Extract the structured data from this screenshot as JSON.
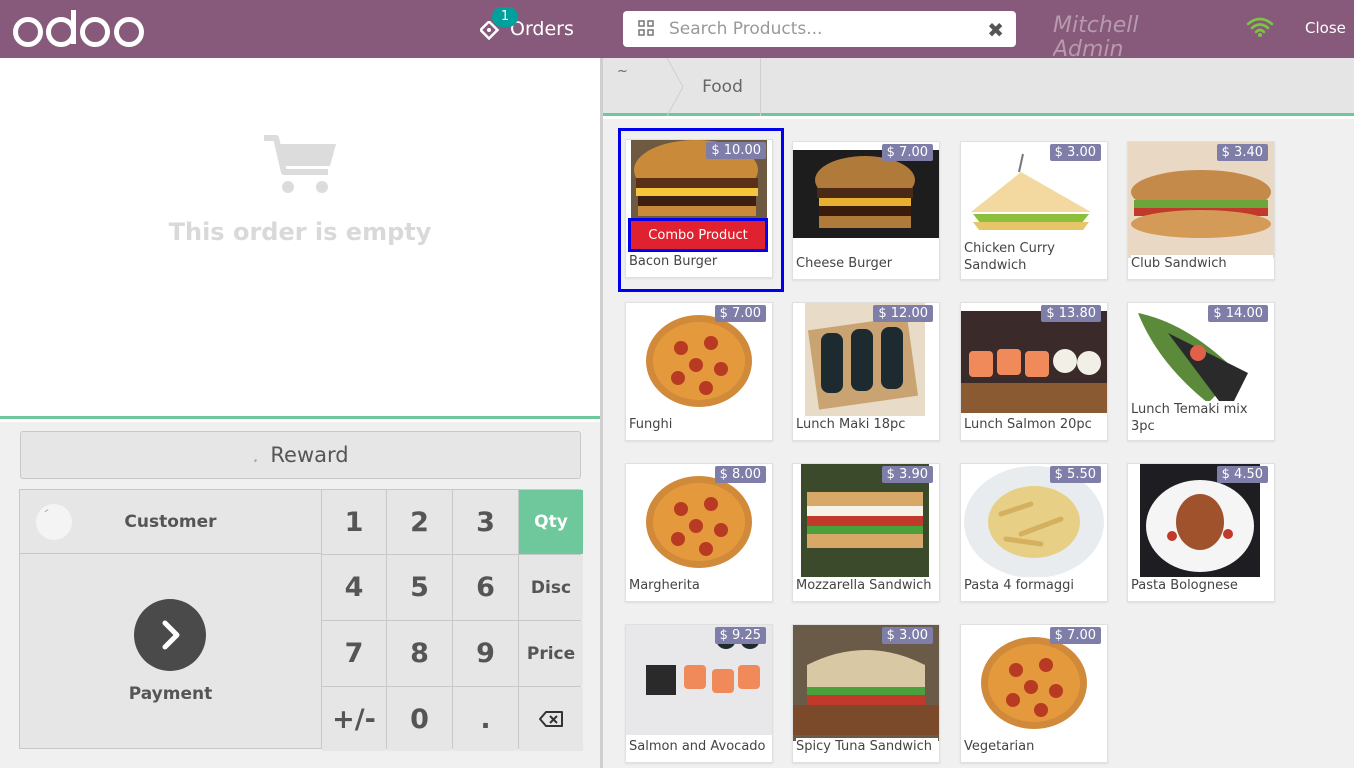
{
  "header": {
    "logo_text": "odoo",
    "orders_label": "Orders",
    "orders_count": "1",
    "search_placeholder": "Search Products...",
    "cashier": "Mitchell Admin",
    "close_label": "Close",
    "brand_color": "#875a7b"
  },
  "order": {
    "empty_text": "This order is empty"
  },
  "controls": {
    "reward_label": "Reward",
    "customer_label": "Customer",
    "payment_label": "Payment",
    "keys": [
      "1",
      "2",
      "3",
      "Qty",
      "4",
      "5",
      "6",
      "Disc",
      "7",
      "8",
      "9",
      "Price",
      "+/-",
      "0",
      "."
    ],
    "active_mode": "Qty"
  },
  "breadcrumb": {
    "home_icon": "home-icon",
    "category": "Food"
  },
  "products": [
    {
      "name": "Bacon Burger",
      "price": "$ 10.00",
      "tag": "Combo Product",
      "img": "burger"
    },
    {
      "name": "Cheese Burger",
      "price": "$ 7.00",
      "img": "burger-dark"
    },
    {
      "name": "Chicken Curry Sandwich",
      "price": "$ 3.00",
      "img": "sandwich-tri"
    },
    {
      "name": "Club Sandwich",
      "price": "$ 3.40",
      "img": "club"
    },
    {
      "name": "Funghi",
      "price": "$ 7.00",
      "img": "pizza"
    },
    {
      "name": "Lunch Maki 18pc",
      "price": "$ 12.00",
      "img": "maki"
    },
    {
      "name": "Lunch Salmon 20pc",
      "price": "$ 13.80",
      "img": "salmon"
    },
    {
      "name": "Lunch Temaki mix 3pc",
      "price": "$ 14.00",
      "img": "temaki"
    },
    {
      "name": "Margherita",
      "price": "$ 8.00",
      "img": "pizza"
    },
    {
      "name": "Mozzarella Sandwich",
      "price": "$ 3.90",
      "img": "mozz"
    },
    {
      "name": "Pasta 4 formaggi",
      "price": "$ 5.50",
      "img": "pasta"
    },
    {
      "name": "Pasta Bolognese",
      "price": "$ 4.50",
      "img": "bolognese"
    },
    {
      "name": "Salmon and Avocado",
      "price": "$ 9.25",
      "img": "sushi-plate"
    },
    {
      "name": "Spicy Tuna Sandwich",
      "price": "$ 3.00",
      "img": "panini"
    },
    {
      "name": "Vegetarian",
      "price": "$ 7.00",
      "img": "pizza"
    }
  ]
}
